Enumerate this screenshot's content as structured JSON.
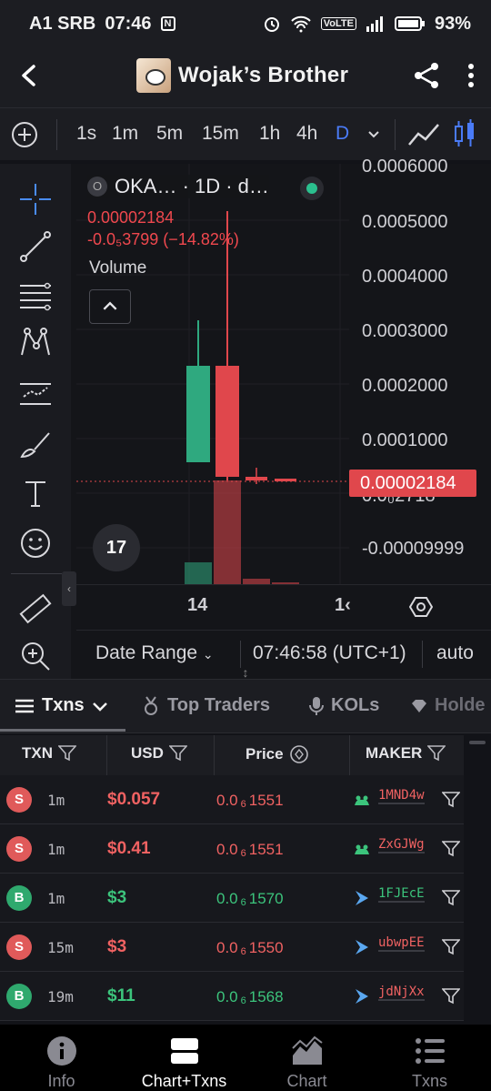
{
  "status_bar": {
    "carrier": "A1 SRB",
    "time": "07:46",
    "volte": "VoLTE",
    "battery": "93%"
  },
  "header": {
    "title": "Wojak’s Brother"
  },
  "timeframes": [
    "1s",
    "1m",
    "5m",
    "15m",
    "1h",
    "4h",
    "D"
  ],
  "active_timeframe": "D",
  "chart": {
    "legend_badge": "O",
    "symbol": "OKA…  · 1D · d…",
    "price": "0.00002184",
    "change": "-0.0₅3799 (−14.82%)",
    "volume_label": "Volume",
    "y_axis_labels": [
      "0.0006000",
      "0.0005000",
      "0.0004000",
      "0.0003000",
      "0.0002000",
      "0.0001000",
      "0.0₀2718",
      "-0.00009999"
    ],
    "current_price_tag": "0.00002184",
    "x_ticks": [
      "14",
      "1‹"
    ],
    "tv_logo": "17",
    "accent_up": "#2fa97f",
    "accent_down": "#e0474c"
  },
  "range_bar": {
    "label": "Date Range",
    "time": "07:46:58 (UTC+1)",
    "auto": "auto"
  },
  "tabs": [
    {
      "label": "Txns",
      "active": true
    },
    {
      "label": "Top Traders",
      "active": false
    },
    {
      "label": "KOLs",
      "active": false
    },
    {
      "label": "Holde",
      "active": false
    }
  ],
  "table": {
    "headers": {
      "txn": "TXN",
      "usd": "USD",
      "price": "Price",
      "maker": "MAKER"
    },
    "rows": [
      {
        "side": "S",
        "age": "1m",
        "usd": "$0.057",
        "price_pre": "0.0",
        "price_sub": "6",
        "price_post": "1551",
        "maker": "1MND4w"
      },
      {
        "side": "S",
        "age": "1m",
        "usd": "$0.41",
        "price_pre": "0.0",
        "price_sub": "6",
        "price_post": "1551",
        "maker": "ZxGJWg"
      },
      {
        "side": "B",
        "age": "1m",
        "usd": "$3",
        "price_pre": "0.0",
        "price_sub": "6",
        "price_post": "1570",
        "maker": "1FJEcE"
      },
      {
        "side": "S",
        "age": "15m",
        "usd": "$3",
        "price_pre": "0.0",
        "price_sub": "6",
        "price_post": "1550",
        "maker": "ubwpEE"
      },
      {
        "side": "B",
        "age": "19m",
        "usd": "$11",
        "price_pre": "0.0",
        "price_sub": "6",
        "price_post": "1568",
        "maker": "jdNjXx"
      }
    ]
  },
  "bottom_nav": [
    {
      "label": "Info",
      "icon": "info-icon"
    },
    {
      "label": "Chart+Txns",
      "icon": "chart-txns-icon",
      "active": true
    },
    {
      "label": "Chart",
      "icon": "chart-icon"
    },
    {
      "label": "Txns",
      "icon": "list-icon"
    }
  ]
}
